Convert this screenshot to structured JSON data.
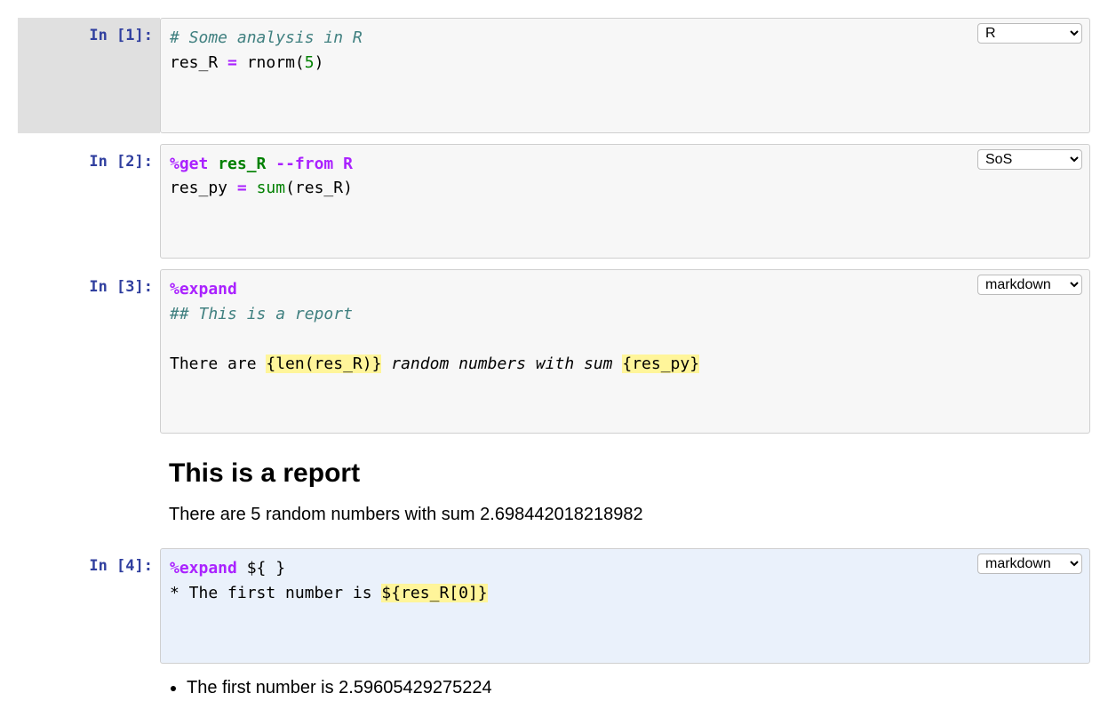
{
  "cells": {
    "c1": {
      "prompt": "In [1]:",
      "kernel": "R",
      "code": {
        "comment": "# Some analysis in R",
        "var": "res_R",
        "eq": "=",
        "func": "rnorm",
        "lp": "(",
        "arg": "5",
        "rp": ")"
      }
    },
    "c2": {
      "prompt": "In [2]:",
      "kernel": "SoS",
      "code": {
        "magic": "%get",
        "mvar": "res_R",
        "flag": "--from R",
        "var": "res_py",
        "eq": "=",
        "func": "sum",
        "lp": "(",
        "arg": "res_R",
        "rp": ")"
      }
    },
    "c3": {
      "prompt": "In [3]:",
      "kernel": "markdown",
      "code": {
        "magic": "%expand",
        "mdline": "## This is a report",
        "pre": "There are ",
        "hl1": "{len(res_R)}",
        "mid": " random numbers with sum ",
        "hl2": "{res_py}"
      },
      "output": {
        "heading": "This is a report",
        "text": "There are 5 random numbers with sum 2.698442018218982"
      }
    },
    "c4": {
      "prompt": "In [4]:",
      "kernel": "markdown",
      "code": {
        "magic": "%expand",
        "magic_arg": "${ }",
        "pre": "* The first number is ",
        "hl": "${res_R[0]}"
      },
      "output": {
        "bullet": "The first number is 2.59605429275224"
      }
    }
  },
  "kernel_options": [
    "R",
    "SoS",
    "markdown"
  ]
}
